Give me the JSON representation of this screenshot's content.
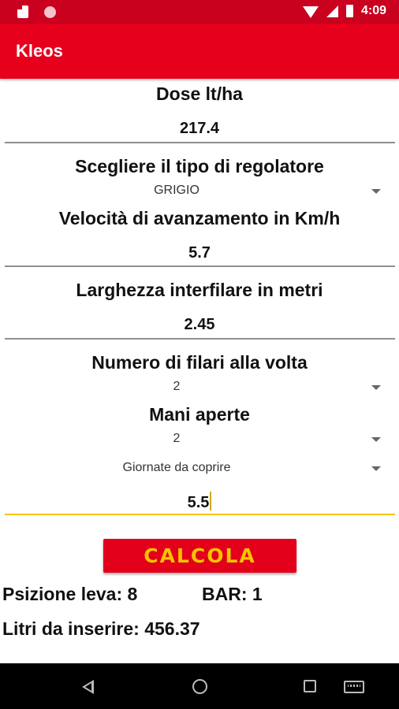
{
  "status": {
    "time": "4:09"
  },
  "app": {
    "title": "Kleos"
  },
  "form": {
    "dose_label": "Dose lt/ha",
    "dose_value": "217.4",
    "regulator_label": "Scegliere il tipo di regolatore",
    "regulator_value": "GRIGIO",
    "speed_label": "Velocità di avanzamento in Km/h",
    "speed_value": "5.7",
    "width_label": "Larghezza interfilare in metri",
    "width_value": "2.45",
    "rows_label": "Numero di filari alla volta",
    "rows_value": "2",
    "hands_label": "Mani aperte",
    "hands_value": "2",
    "days_spinner": "Giornate da coprire",
    "days_value": "5.5"
  },
  "actions": {
    "calculate_label": "CALCOLA"
  },
  "results": {
    "lever": "Psizione leva: 8",
    "bar": "BAR: 1",
    "liters": "Litri da inserire: 456.37"
  },
  "icons": {
    "status": [
      "sd-card-icon",
      "notification-dot-icon",
      "wifi-icon",
      "signal-icon",
      "battery-icon"
    ],
    "nav": [
      "back-icon",
      "home-icon",
      "recents-icon",
      "keyboard-icon"
    ]
  },
  "colors": {
    "primary": "#e6001c",
    "status_bar": "#c9001e",
    "button_text": "#f6c400",
    "focus_underline": "#f2c416"
  }
}
